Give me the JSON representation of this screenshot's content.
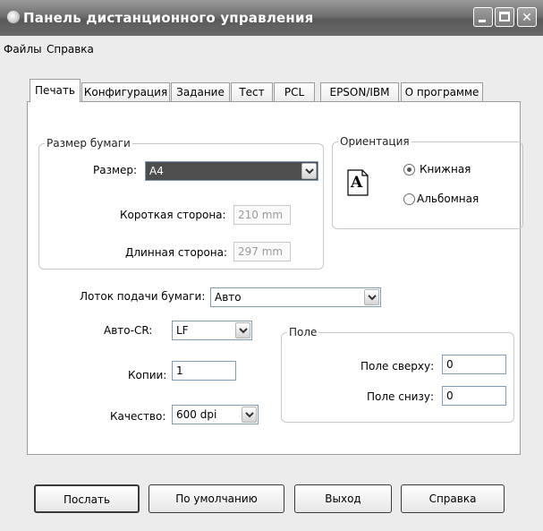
{
  "window": {
    "title": "Панель дистанционного управления"
  },
  "menu": {
    "items": [
      "Файлы",
      "Справка"
    ]
  },
  "tabs": [
    "Печать",
    "Конфигурация",
    "Задание",
    "Тест",
    "PCL",
    "EPSON/IBM",
    "О программе"
  ],
  "paper": {
    "group_label": "Размер бумаги",
    "size_label": "Размер:",
    "size_value": "A4",
    "short_label": "Короткая сторона:",
    "short_value": "210 mm",
    "long_label": "Длинная сторона:",
    "long_value": "297 mm"
  },
  "orientation": {
    "group_label": "Ориентация",
    "icon_letter": "A",
    "portrait": "Книжная",
    "landscape": "Альбомная",
    "selected": "portrait"
  },
  "tray": {
    "label": "Лоток подачи бумаги:",
    "value": "Авто"
  },
  "autocr": {
    "label": "Авто-CR:",
    "value": "LF"
  },
  "copies": {
    "label": "Копии:",
    "value": "1"
  },
  "quality": {
    "label": "Качество:",
    "value": "600 dpi"
  },
  "margins": {
    "group_label": "Поле",
    "top_label": "Поле сверху:",
    "top_value": "0",
    "bottom_label": "Поле снизу:",
    "bottom_value": "0"
  },
  "buttons": {
    "send": "Послать",
    "defaults": "По умолчанию",
    "exit": "Выход",
    "help": "Справка"
  }
}
